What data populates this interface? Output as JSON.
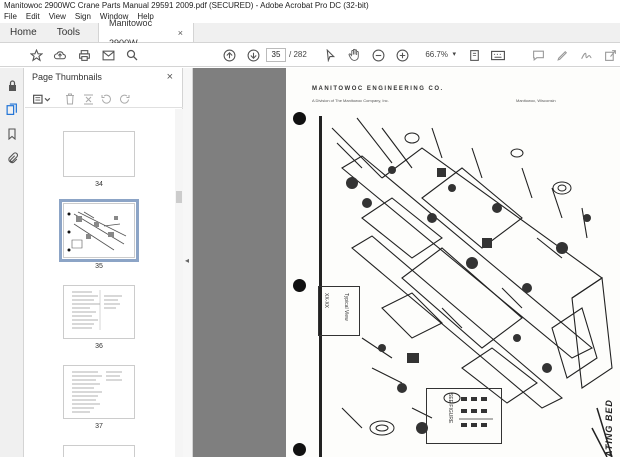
{
  "window": {
    "title": "Manitowoc 2900WC Crane Parts Manual 29591 2009.pdf (SECURED) - Adobe Acrobat Pro DC (32-bit)"
  },
  "menu": [
    "File",
    "Edit",
    "View",
    "Sign",
    "Window",
    "Help"
  ],
  "tabs": {
    "home": "Home",
    "tools": "Tools",
    "document": "Manitowoc 2900W...",
    "document_close": "×"
  },
  "toolbar": {
    "current_page": "35",
    "total_pages": "/ 282",
    "zoom": "66.7%"
  },
  "panel": {
    "title": "Page Thumbnails",
    "close": "×",
    "thumbnails": [
      {
        "label": "34"
      },
      {
        "label": "35",
        "selected": true
      },
      {
        "label": "36"
      },
      {
        "label": "37"
      }
    ]
  },
  "document_page": {
    "header": "MANITOWOC ENGINEERING CO.",
    "subheader_left": "A Division of The Manitowoc Company, Inc.",
    "subheader_right": "Manitowoc, Wisconsin",
    "inset_label": "Typical View",
    "inset_label2": "XX-XX",
    "inset2_label": "SEE FIGURE",
    "bottom_title": "ATING BED"
  },
  "icons": {
    "star": "star-icon",
    "cloud": "cloud-upload-icon",
    "print": "print-icon",
    "mail": "mail-icon",
    "search": "search-icon",
    "up": "arrow-up-icon",
    "down": "arrow-down-icon",
    "hand": "hand-icon",
    "zoom_out": "zoom-out-icon",
    "zoom_in": "zoom-in-icon"
  }
}
